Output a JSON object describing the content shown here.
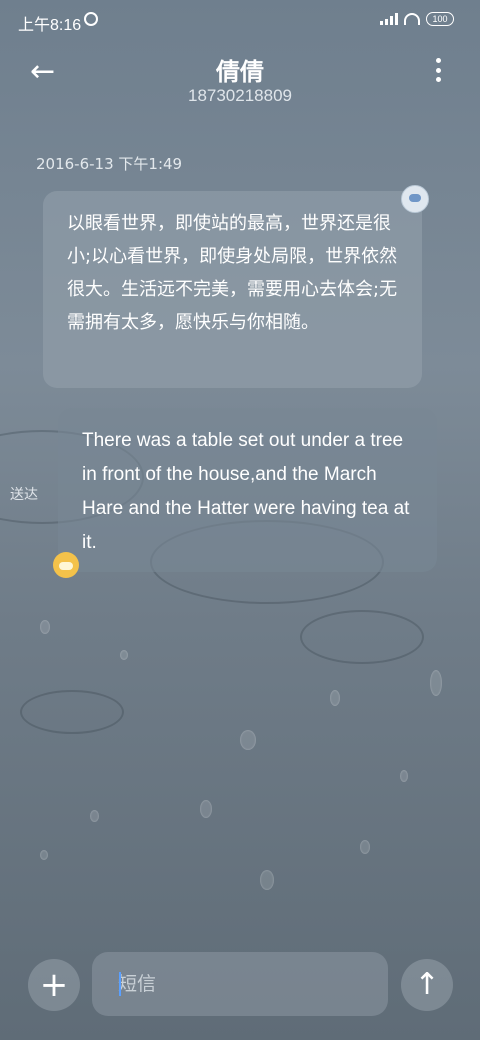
{
  "status_bar": {
    "time": "上午8:16",
    "battery": "100"
  },
  "header": {
    "back_icon": "arrow-left-icon",
    "contact_name": "倩倩",
    "phone_number": "18730218809",
    "menu_icon": "more-vertical-icon"
  },
  "conversation": {
    "timestamp": "2016-6-13 下午1:49",
    "messages": [
      {
        "direction": "incoming",
        "text": "以眼看世界，即使站的最高，世界还是很小;以心看世界，即使身处局限，世界依然很大。生活远不完美，需要用心去体会;无需拥有太多，愿快乐与你相随。"
      },
      {
        "direction": "outgoing",
        "text": "There was a table set out under a tree in front of the house,and the March Hare and the Hatter were having tea at it.",
        "status": "送达"
      }
    ]
  },
  "composer": {
    "add_icon": "plus-icon",
    "placeholder": "短信",
    "value": "",
    "send_icon": "arrow-up-icon"
  }
}
